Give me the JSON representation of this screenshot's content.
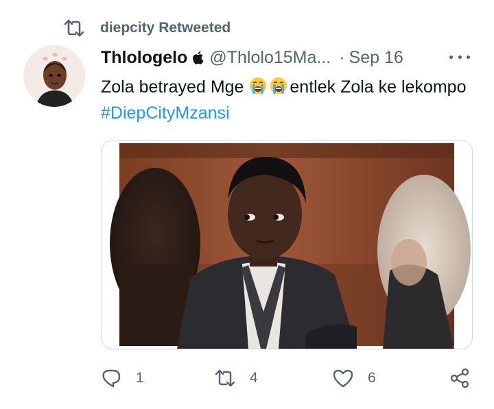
{
  "retweet": {
    "icon": "retweet-icon",
    "label": "diepcity Retweeted"
  },
  "author": {
    "display_name": "Thlologelo",
    "badge_icon": "apple-icon",
    "handle": "@Thlolo15Ma...",
    "separator": "·",
    "date": "Sep 16"
  },
  "tweet": {
    "text_part1": "Zola betrayed Mge",
    "emoji_icon": "loudly-crying-face-emoji",
    "text_part2": "entlek Zola ke lekompo",
    "hashtag": "#DiepCityMzansi"
  },
  "actions": {
    "reply_count": "1",
    "retweet_count": "4",
    "like_count": "6"
  },
  "colors": {
    "text": "#0f1419",
    "secondary": "#536471",
    "link": "#1d9bf0",
    "border": "#cfd9de"
  }
}
